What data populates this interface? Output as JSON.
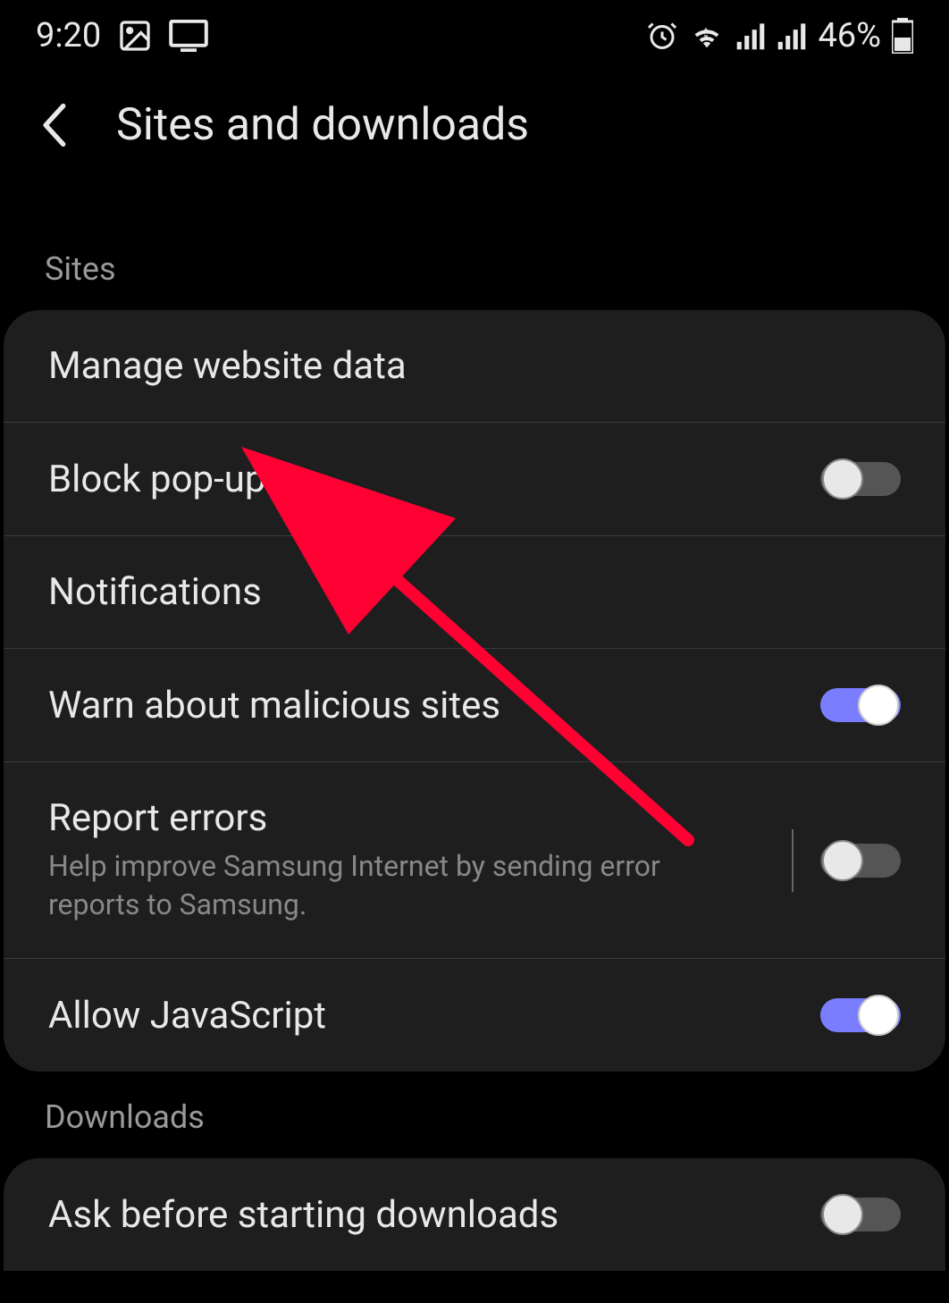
{
  "status_bar": {
    "time": "9:20",
    "battery_percent": "46%"
  },
  "header": {
    "title": "Sites and downloads"
  },
  "sections": {
    "sites": {
      "label": "Sites",
      "items": [
        {
          "title": "Manage website data",
          "toggle": null
        },
        {
          "title": "Block pop-ups",
          "toggle": false
        },
        {
          "title": "Notifications",
          "toggle": null
        },
        {
          "title": "Warn about malicious sites",
          "toggle": true
        },
        {
          "title": "Report errors",
          "subtitle": "Help improve Samsung Internet by sending error reports to Samsung.",
          "toggle": false,
          "divider": true
        },
        {
          "title": "Allow JavaScript",
          "toggle": true
        }
      ]
    },
    "downloads": {
      "label": "Downloads",
      "items": [
        {
          "title": "Ask before starting downloads",
          "toggle": false
        }
      ]
    }
  }
}
